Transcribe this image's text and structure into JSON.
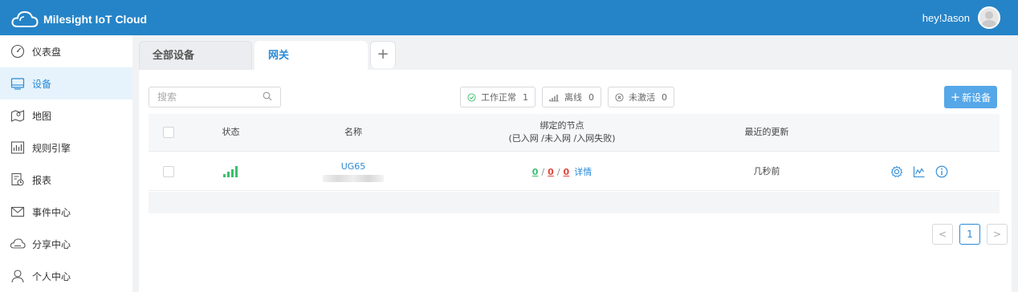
{
  "header": {
    "brand": "Milesight IoT Cloud",
    "user_greeting": "hey!Jason"
  },
  "sidebar": {
    "items": [
      {
        "label": "仪表盘",
        "icon": "dashboard-icon",
        "active": false
      },
      {
        "label": "设备",
        "icon": "device-icon",
        "active": true
      },
      {
        "label": "地图",
        "icon": "map-icon",
        "active": false
      },
      {
        "label": "规则引擎",
        "icon": "rule-engine-icon",
        "active": false
      },
      {
        "label": "报表",
        "icon": "report-icon",
        "active": false
      },
      {
        "label": "事件中心",
        "icon": "mail-icon",
        "active": false
      },
      {
        "label": "分享中心",
        "icon": "cloud-share-icon",
        "active": false
      },
      {
        "label": "个人中心",
        "icon": "person-icon",
        "active": false
      }
    ]
  },
  "tabs": {
    "all_devices": "全部设备",
    "gateway": "网关",
    "add": "+"
  },
  "toolbar": {
    "search_placeholder": "搜索",
    "filters": [
      {
        "label": "工作正常",
        "count": "1",
        "icon": "check-circle-icon"
      },
      {
        "label": "离线",
        "count": "0",
        "icon": "signal-offline-icon"
      },
      {
        "label": "未激活",
        "count": "0",
        "icon": "x-circle-icon"
      }
    ],
    "new_device": "新设备"
  },
  "table": {
    "headers": {
      "status": "状态",
      "name": "名称",
      "nodes_title": "绑定的节点",
      "nodes_sub": "(已入网 /未入网 /入网失败)",
      "last_update": "最近的更新"
    },
    "rows": [
      {
        "name": "UG65",
        "nodes_joined": "0",
        "nodes_not_joined": "0",
        "nodes_failed": "0",
        "details": "详情",
        "last_update": "几秒前",
        "signal_bars": 4
      }
    ]
  },
  "pagination": {
    "prev": "<",
    "current": "1",
    "next": ">"
  },
  "colors": {
    "header": "#2584c8",
    "accent": "#2a8ad6",
    "ok": "#3cbf6e",
    "error": "#e0463c"
  }
}
